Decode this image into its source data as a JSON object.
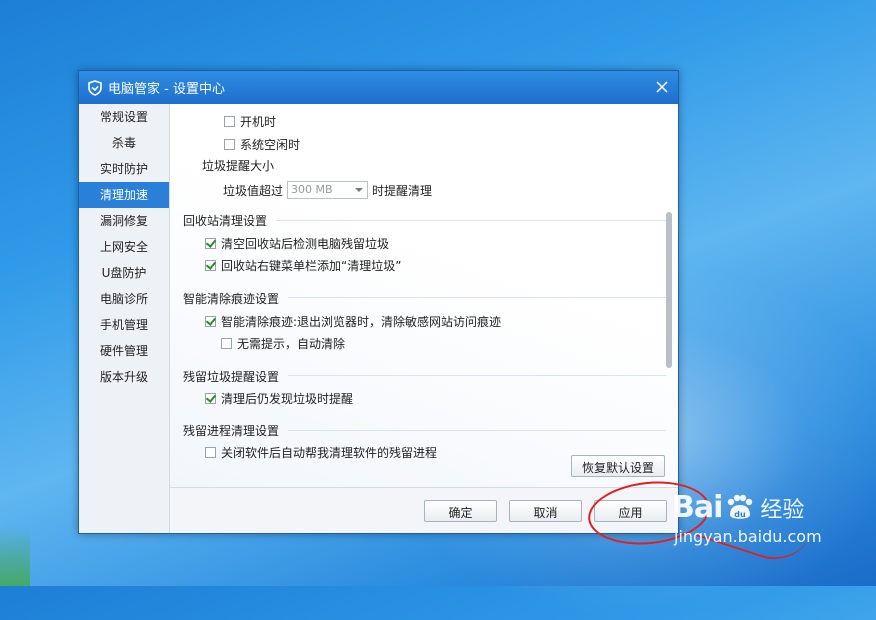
{
  "window": {
    "title": "电脑管家 - 设置中心"
  },
  "sidebar": {
    "items": [
      {
        "label": "常规设置"
      },
      {
        "label": "杀毒"
      },
      {
        "label": "实时防护"
      },
      {
        "label": "清理加速",
        "active": true
      },
      {
        "label": "漏洞修复"
      },
      {
        "label": "上网安全"
      },
      {
        "label": "U盘防护"
      },
      {
        "label": "电脑诊所"
      },
      {
        "label": "手机管理"
      },
      {
        "label": "硬件管理"
      },
      {
        "label": "版本升级"
      }
    ]
  },
  "content": {
    "opt_boot": {
      "label": "开机时",
      "checked": false
    },
    "opt_idle": {
      "label": "系统空闲时",
      "checked": false
    },
    "size_title": "垃圾提醒大小",
    "threshold_prefix": "垃圾值超过",
    "threshold_value": "300 MB",
    "threshold_suffix": "时提醒清理",
    "recycle": {
      "title": "回收站清理设置",
      "opt1": {
        "label": "清空回收站后检测电脑残留垃圾",
        "checked": true
      },
      "opt2": {
        "label": "回收站右键菜单栏添加“清理垃圾”",
        "checked": true
      }
    },
    "trace": {
      "title": "智能清除痕迹设置",
      "opt1": {
        "label": "智能清除痕迹:退出浏览器时，清除敏感网站访问痕迹",
        "checked": true
      },
      "opt2": {
        "label": "无需提示，自动清除",
        "checked": false
      }
    },
    "residual": {
      "title": "残留垃圾提醒设置",
      "opt1": {
        "label": "清理后仍发现垃圾时提醒",
        "checked": true
      }
    },
    "process": {
      "title": "残留进程清理设置",
      "opt1": {
        "label": "关闭软件后自动帮我清理软件的残留进程",
        "checked": false
      }
    },
    "restore_button": "恢复默认设置"
  },
  "footer": {
    "ok": "确定",
    "cancel": "取消",
    "apply": "应用"
  },
  "watermark": {
    "logo_left": "Bai",
    "logo_mark": "du",
    "logo_right": "经验",
    "url": "jingyan.baidu.com"
  },
  "colors": {
    "title_bar": "#1e6fcc",
    "active_nav": "#2a7fd8",
    "annotation": "#e02020"
  }
}
